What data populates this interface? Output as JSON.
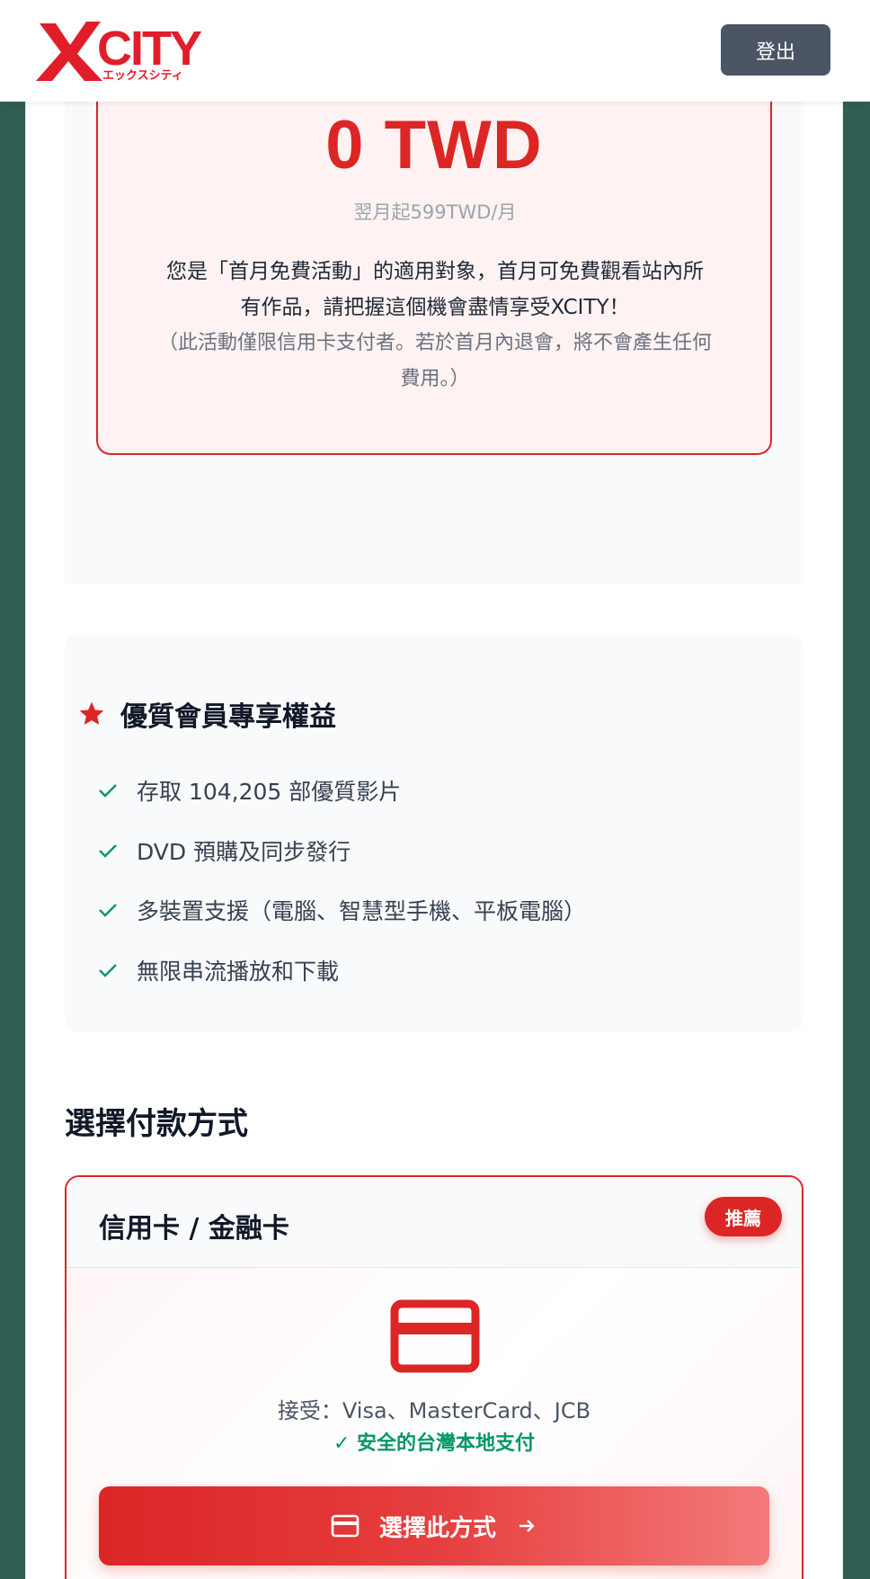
{
  "header": {
    "logo_text": "XCITY",
    "logo_sub": "エックスシティ",
    "logout_label": "登出"
  },
  "promo": {
    "price": "0 TWD",
    "next_month": "翌月起599TWD/月",
    "desc_line1": "您是「首月免費活動」的適用對象，首月可免費觀看站內所",
    "desc_line2": "有作品，請把握這個機會盡情享受XCITY！",
    "note_line1": "（此活動僅限信用卡支付者。若於首月內退會，將不會產生任何",
    "note_line2": "費用。）"
  },
  "benefits": {
    "title": "優質會員專享權益",
    "items": [
      "存取 104,205 部優質影片",
      "DVD 預購及同步發行",
      "多裝置支援（電腦、智慧型手機、平板電腦）",
      "無限串流播放和下載"
    ]
  },
  "payment": {
    "heading": "選擇付款方式",
    "card_title": "信用卡 / 金融卡",
    "badge": "推薦",
    "accept": "接受：Visa、MasterCard、JCB",
    "secure": "安全的台灣本地支付",
    "select_label": "選擇此方式"
  },
  "colors": {
    "brand_red": "#dc2626",
    "success_green": "#059669",
    "logout_gray": "#4b5563"
  }
}
